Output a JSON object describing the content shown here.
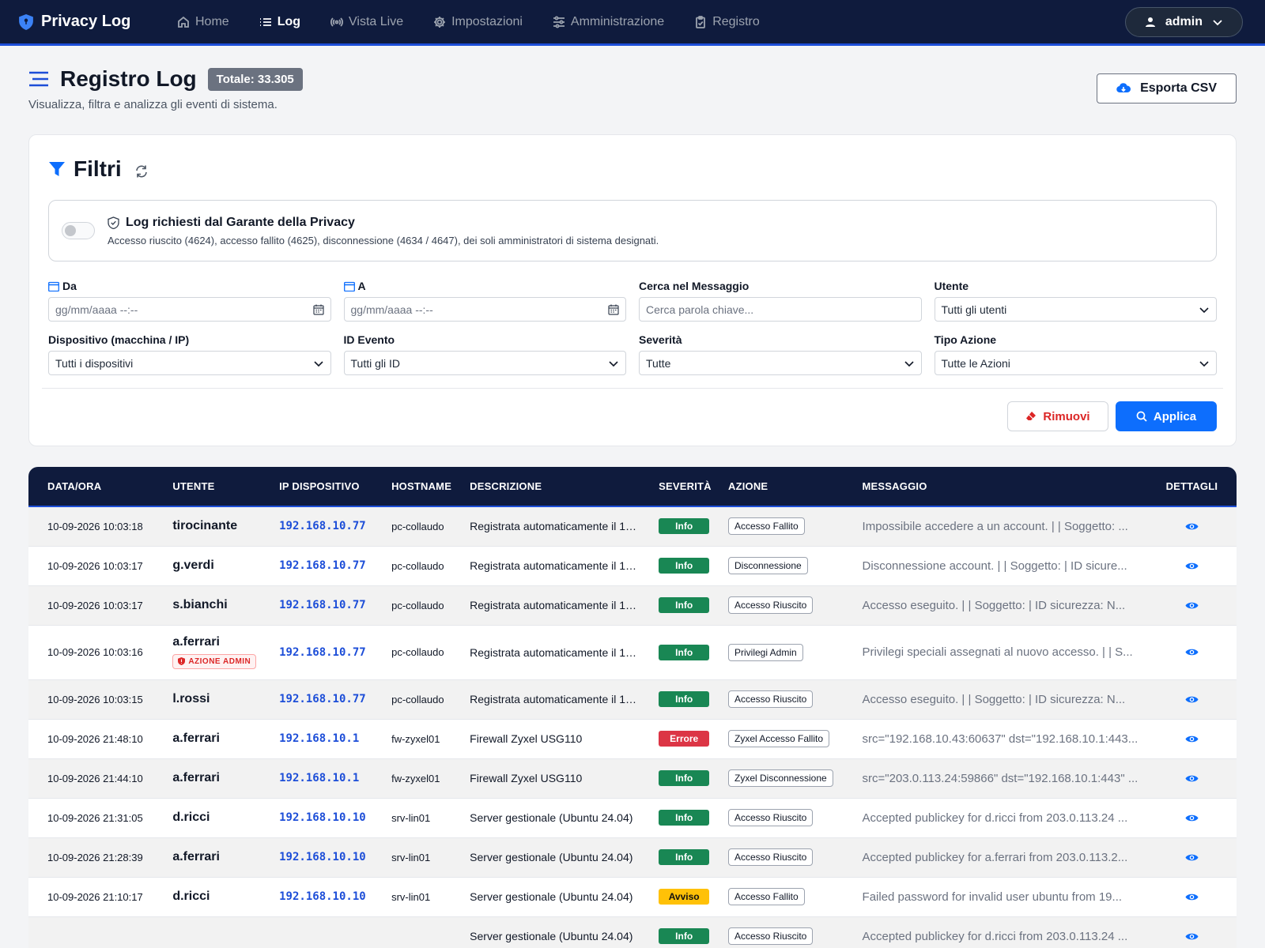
{
  "nav": {
    "brand": "Privacy Log",
    "items": [
      {
        "label": "Home",
        "icon": "home-icon"
      },
      {
        "label": "Log",
        "icon": "list-icon",
        "active": true
      },
      {
        "label": "Vista Live",
        "icon": "broadcast-icon"
      },
      {
        "label": "Impostazioni",
        "icon": "gear-icon"
      },
      {
        "label": "Amministrazione",
        "icon": "sliders-icon"
      },
      {
        "label": "Registro",
        "icon": "clipboard-icon"
      }
    ],
    "user": "admin"
  },
  "header": {
    "title": "Registro Log",
    "total": "Totale: 33.305",
    "subtitle": "Visualizza, filtra e analizza gli eventi di sistema.",
    "export_label": "Esporta CSV"
  },
  "filters": {
    "title": "Filtri",
    "privacy_title": "Log richiesti dal Garante della Privacy",
    "privacy_desc": "Accesso riuscito (4624), accesso fallito (4625), disconnessione (4634 / 4647), dei soli amministratori di sistema designati.",
    "fields": {
      "da_label": "Da",
      "da_placeholder": "gg/mm/aaaa --:--",
      "a_label": "A",
      "a_placeholder": "gg/mm/aaaa --:--",
      "cerca_label": "Cerca nel Messaggio",
      "cerca_placeholder": "Cerca parola chiave...",
      "utente_label": "Utente",
      "utente_value": "Tutti gli utenti",
      "dispositivo_label": "Dispositivo (macchina / IP)",
      "dispositivo_value": "Tutti i dispositivi",
      "idevento_label": "ID Evento",
      "idevento_value": "Tutti gli ID",
      "severita_label": "Severità",
      "severita_value": "Tutte",
      "tipo_label": "Tipo Azione",
      "tipo_value": "Tutte le Azioni"
    },
    "remove_label": "Rimuovi",
    "apply_label": "Applica"
  },
  "table": {
    "headers": [
      "DATA/ORA",
      "UTENTE",
      "IP DISPOSITIVO",
      "HOSTNAME",
      "DESCRIZIONE",
      "SEVERITÀ",
      "AZIONE",
      "MESSAGGIO",
      "DETTAGLI"
    ],
    "admin_tag": "AZIONE ADMIN",
    "rows": [
      {
        "datetime": "10-09-2026 10:03:18",
        "user": "tirocinante",
        "ip": "192.168.10.77",
        "host": "pc-collaudo",
        "desc": "Registrata automaticamente il 10...",
        "sev": "Info",
        "action": "Accesso Fallito",
        "msg": "Impossibile accedere a un account. | | Soggetto: ..."
      },
      {
        "datetime": "10-09-2026 10:03:17",
        "user": "g.verdi",
        "ip": "192.168.10.77",
        "host": "pc-collaudo",
        "desc": "Registrata automaticamente il 10...",
        "sev": "Info",
        "action": "Disconnessione",
        "msg": "Disconnessione account. | | Soggetto: | ID sicure..."
      },
      {
        "datetime": "10-09-2026 10:03:17",
        "user": "s.bianchi",
        "ip": "192.168.10.77",
        "host": "pc-collaudo",
        "desc": "Registrata automaticamente il 10...",
        "sev": "Info",
        "action": "Accesso Riuscito",
        "msg": "Accesso eseguito. | | Soggetto: | ID sicurezza: N..."
      },
      {
        "datetime": "10-09-2026 10:03:16",
        "user": "a.ferrari",
        "admin": true,
        "ip": "192.168.10.77",
        "host": "pc-collaudo",
        "desc": "Registrata automaticamente il 10...",
        "sev": "Info",
        "action": "Privilegi Admin",
        "msg": "Privilegi speciali assegnati al nuovo accesso. | | S..."
      },
      {
        "datetime": "10-09-2026 10:03:15",
        "user": "l.rossi",
        "ip": "192.168.10.77",
        "host": "pc-collaudo",
        "desc": "Registrata automaticamente il 10...",
        "sev": "Info",
        "action": "Accesso Riuscito",
        "msg": "Accesso eseguito. | | Soggetto: | ID sicurezza: N..."
      },
      {
        "datetime": "10-09-2026 21:48:10",
        "user": "a.ferrari",
        "ip": "192.168.10.1",
        "host": "fw-zyxel01",
        "desc": "Firewall Zyxel USG110",
        "sev": "Errore",
        "action": "Zyxel Accesso Fallito",
        "msg": "src=\"192.168.10.43:60637\" dst=\"192.168.10.1:443..."
      },
      {
        "datetime": "10-09-2026 21:44:10",
        "user": "a.ferrari",
        "ip": "192.168.10.1",
        "host": "fw-zyxel01",
        "desc": "Firewall Zyxel USG110",
        "sev": "Info",
        "action": "Zyxel Disconnessione",
        "msg": "src=\"203.0.113.24:59866\" dst=\"192.168.10.1:443\" ..."
      },
      {
        "datetime": "10-09-2026 21:31:05",
        "user": "d.ricci",
        "ip": "192.168.10.10",
        "host": "srv-lin01",
        "desc": "Server gestionale (Ubuntu 24.04)",
        "sev": "Info",
        "action": "Accesso Riuscito",
        "msg": "Accepted publickey for d.ricci from 203.0.113.24 ..."
      },
      {
        "datetime": "10-09-2026 21:28:39",
        "user": "a.ferrari",
        "ip": "192.168.10.10",
        "host": "srv-lin01",
        "desc": "Server gestionale (Ubuntu 24.04)",
        "sev": "Info",
        "action": "Accesso Riuscito",
        "msg": "Accepted publickey for a.ferrari from 203.0.113.2..."
      },
      {
        "datetime": "10-09-2026 21:10:17",
        "user": "d.ricci",
        "ip": "192.168.10.10",
        "host": "srv-lin01",
        "desc": "Server gestionale (Ubuntu 24.04)",
        "sev": "Avviso",
        "action": "Accesso Fallito",
        "msg": "Failed password for invalid user ubuntu from 19..."
      },
      {
        "datetime": "",
        "user": "",
        "ip": "",
        "host": "",
        "desc": "Server gestionale (Ubuntu 24.04)",
        "sev": "Info",
        "action": "Accesso Riuscito",
        "msg": "Accepted publickey for d.ricci from 203.0.113.24 ..."
      }
    ]
  },
  "colors": {
    "navbar": "#0f1b3d",
    "accent": "#0d6efd",
    "info": "#198754",
    "errore": "#dc3545",
    "avviso": "#ffc107"
  }
}
